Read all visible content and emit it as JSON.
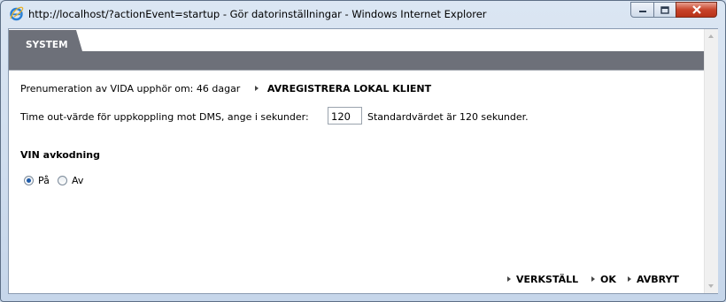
{
  "window": {
    "title": "http://localhost/?actionEvent=startup - Gör datorinställningar - Windows Internet Explorer"
  },
  "tabs": [
    {
      "label": "SYSTEM",
      "active": true
    }
  ],
  "subscription": {
    "text": "Prenumeration av VIDA upphör om: 46 dagar",
    "unregister_link": "AVREGISTRERA LOKAL KLIENT"
  },
  "timeout": {
    "label": "Time out-värde för uppkoppling mot DMS, ange i sekunder:",
    "value": "120",
    "hint": "Standardvärdet är 120 sekunder."
  },
  "vin": {
    "heading": "VIN avkodning",
    "options": [
      {
        "label": "På",
        "checked": true
      },
      {
        "label": "Av",
        "checked": false
      }
    ]
  },
  "actions": {
    "apply": "VERKSTÄLL",
    "ok": "OK",
    "cancel": "AVBRYT"
  },
  "colors": {
    "tab_bar": "#6d7079",
    "window_frame": "#cfdcec",
    "close_button": "#c8442b",
    "radio_selected": "#1d5aa9"
  }
}
